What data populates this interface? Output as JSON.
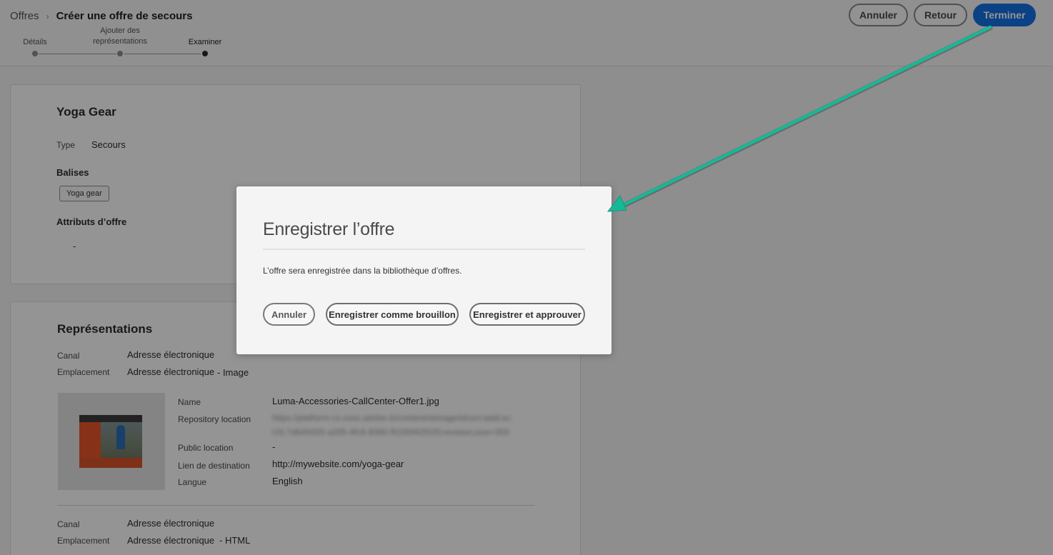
{
  "breadcrumb": {
    "parent": "Offres",
    "separator": "›",
    "current": "Créer une offre de secours"
  },
  "stepper": {
    "steps": [
      {
        "label": "Détails",
        "state": "done"
      },
      {
        "label": "Ajouter des représentations",
        "state": "done"
      },
      {
        "label": "Examiner",
        "state": "current"
      }
    ]
  },
  "header_buttons": {
    "cancel": "Annuler",
    "back": "Retour",
    "finish": "Terminer"
  },
  "offer_card": {
    "title": "Yoga Gear",
    "type_label": "Type",
    "type_value": "Secours",
    "tags_label": "Balises",
    "tags": [
      "Yoga gear"
    ],
    "attributes_label": "Attributs d’offre",
    "attributes_value": "-"
  },
  "representations": {
    "title": "Représentations",
    "items": [
      {
        "channel_label": "Canal",
        "channel_value": "Adresse électronique",
        "placement_label": "Emplacement",
        "placement_value": "Adresse électronique",
        "placement_suffix": "- Image",
        "name_label": "Name",
        "name_value": "Luma-Accessories-CallCenter-Offer1.jpg",
        "repo_label": "Repository location",
        "repo_value_line1": "https://platform-cs-xxxx.adobe.io/content/storage/id/urn:aaid:sc:",
        "repo_value_line2": "US:7d645005-a205-4fc6-8360-f5330f4291f0;revision;size=300",
        "public_label": "Public location",
        "public_value": "-",
        "dest_label": "Lien de destination",
        "dest_value": "http://mywebsite.com/yoga-gear",
        "lang_label": "Langue",
        "lang_value": "English"
      },
      {
        "channel_label": "Canal",
        "channel_value": "Adresse électronique",
        "placement_label": "Emplacement",
        "placement_value": "Adresse électronique",
        "placement_suffix": "- HTML"
      }
    ]
  },
  "dialog": {
    "title": "Enregistrer l’offre",
    "body": "L’offre sera enregistrée dans la bibliothèque d’offres.",
    "cancel": "Annuler",
    "save_draft": "Enregistrer comme brouillon",
    "save_approve": "Enregistrer et approuver"
  },
  "colors": {
    "accent": "#1473e6",
    "annotation_arrow": "#17b897",
    "overlay": "rgba(0,0,0,0.42)"
  },
  "icons": {
    "breadcrumb_separator": "chevron-right-icon",
    "annotation": "arrow-annotation-icon"
  }
}
